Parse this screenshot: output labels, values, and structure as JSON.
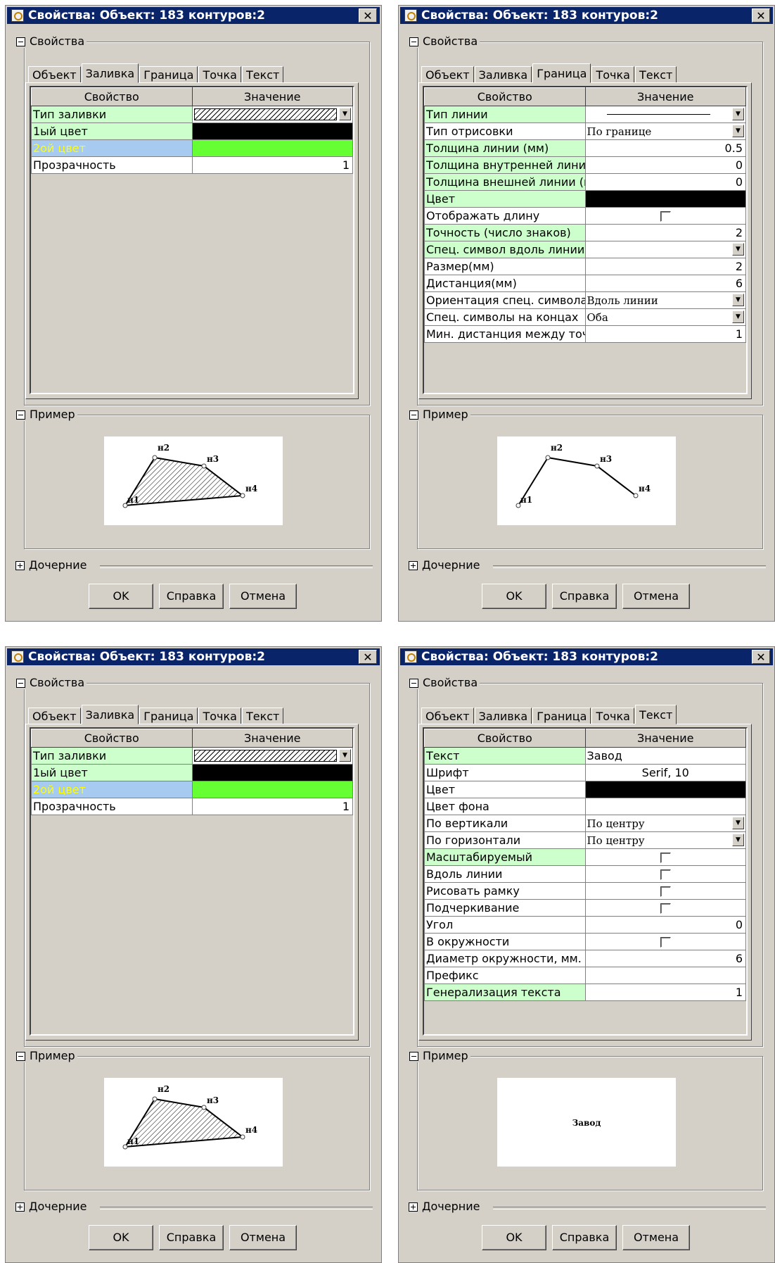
{
  "title": "Свойства: Объект: 183 контуров:2",
  "close_glyph": "✕",
  "groups": {
    "properties": "Свойства",
    "example": "Пример",
    "children": "Дочерние"
  },
  "tabs": [
    "Объект",
    "Заливка",
    "Граница",
    "Точка",
    "Текст"
  ],
  "columns": {
    "name": "Свойство",
    "value": "Значение"
  },
  "buttons": {
    "ok": "OK",
    "help": "Справка",
    "cancel": "Отмена"
  },
  "colors": {
    "highlight_row": "#ccffcc",
    "selected_row": "#a6caf0",
    "green_swatch": "#66ff33",
    "black_swatch": "#000000"
  },
  "fill_tab": {
    "rows": [
      {
        "name": "Тип заливки",
        "value": "",
        "kind": "hatch",
        "hl": true
      },
      {
        "name": "1ый цвет",
        "value": "",
        "kind": "black",
        "hl": true
      },
      {
        "name": "2ой цвет",
        "value": "",
        "kind": "green",
        "sel": true
      },
      {
        "name": "Прозрачность",
        "value": "1",
        "kind": "num"
      }
    ]
  },
  "border_tab": {
    "rows": [
      {
        "name": "Тип линии",
        "value": "",
        "kind": "line",
        "hl": true
      },
      {
        "name": "Тип отрисовки",
        "value": "По границе",
        "kind": "dd"
      },
      {
        "name": "Толщина линии (мм)",
        "value": "0.5",
        "kind": "num",
        "hl": true
      },
      {
        "name": "Толщина внутренней линии",
        "value": "0",
        "kind": "num",
        "hl": true
      },
      {
        "name": "Толщина внешней линии (мм",
        "value": "0",
        "kind": "num",
        "hl": true
      },
      {
        "name": "Цвет",
        "value": "",
        "kind": "black",
        "hl": true
      },
      {
        "name": "Отображать длину",
        "value": "",
        "kind": "cb"
      },
      {
        "name": "Точность (число знаков)",
        "value": "2",
        "kind": "num",
        "hl": true
      },
      {
        "name": "Спец. символ вдоль линии",
        "value": "",
        "kind": "dd",
        "hl": true
      },
      {
        "name": "Размер(мм)",
        "value": "2",
        "kind": "num"
      },
      {
        "name": "Дистанция(мм)",
        "value": "6",
        "kind": "num"
      },
      {
        "name": "Ориентация спец. символа",
        "value": "Вдоль линии",
        "kind": "dd"
      },
      {
        "name": "Спец. символы на концах",
        "value": "Оба",
        "kind": "dd"
      },
      {
        "name": "Мин. дистанция между точк",
        "value": "1",
        "kind": "num"
      }
    ]
  },
  "text_tab": {
    "rows": [
      {
        "name": "Текст",
        "value": "Завод",
        "kind": "text",
        "hl": true
      },
      {
        "name": "Шрифт",
        "value": "Serif, 10",
        "kind": "ctr"
      },
      {
        "name": "Цвет",
        "value": "",
        "kind": "black"
      },
      {
        "name": "Цвет фона",
        "value": "",
        "kind": "text"
      },
      {
        "name": "По вертикали",
        "value": "По центру",
        "kind": "dd"
      },
      {
        "name": "По горизонтали",
        "value": "По центру",
        "kind": "dd"
      },
      {
        "name": "Масштабируемый",
        "value": "",
        "kind": "cb",
        "hl": true
      },
      {
        "name": "Вдоль линии",
        "value": "",
        "kind": "cb"
      },
      {
        "name": "Рисовать рамку",
        "value": "",
        "kind": "cb"
      },
      {
        "name": "Подчеркивание",
        "value": "",
        "kind": "cb"
      },
      {
        "name": "Угол",
        "value": "0",
        "kind": "num"
      },
      {
        "name": "В окружности",
        "value": "",
        "kind": "cb"
      },
      {
        "name": "Диаметр окружности, мм.",
        "value": "6",
        "kind": "num"
      },
      {
        "name": "Префикс",
        "value": "",
        "kind": "text"
      },
      {
        "name": "Генерализация текста",
        "value": "1",
        "kind": "num",
        "hl": true
      }
    ]
  },
  "preview": {
    "points": [
      "н1",
      "н2",
      "н3",
      "н4"
    ],
    "sample_text": "Завод"
  },
  "dialogs": [
    {
      "tab_index": 1,
      "content": "fill_tab",
      "preview": "polygon"
    },
    {
      "tab_index": 2,
      "content": "border_tab",
      "preview": "polyline"
    },
    {
      "tab_index": 1,
      "content": "fill_tab",
      "preview": "polygon"
    },
    {
      "tab_index": 4,
      "content": "text_tab",
      "preview": "text"
    }
  ]
}
